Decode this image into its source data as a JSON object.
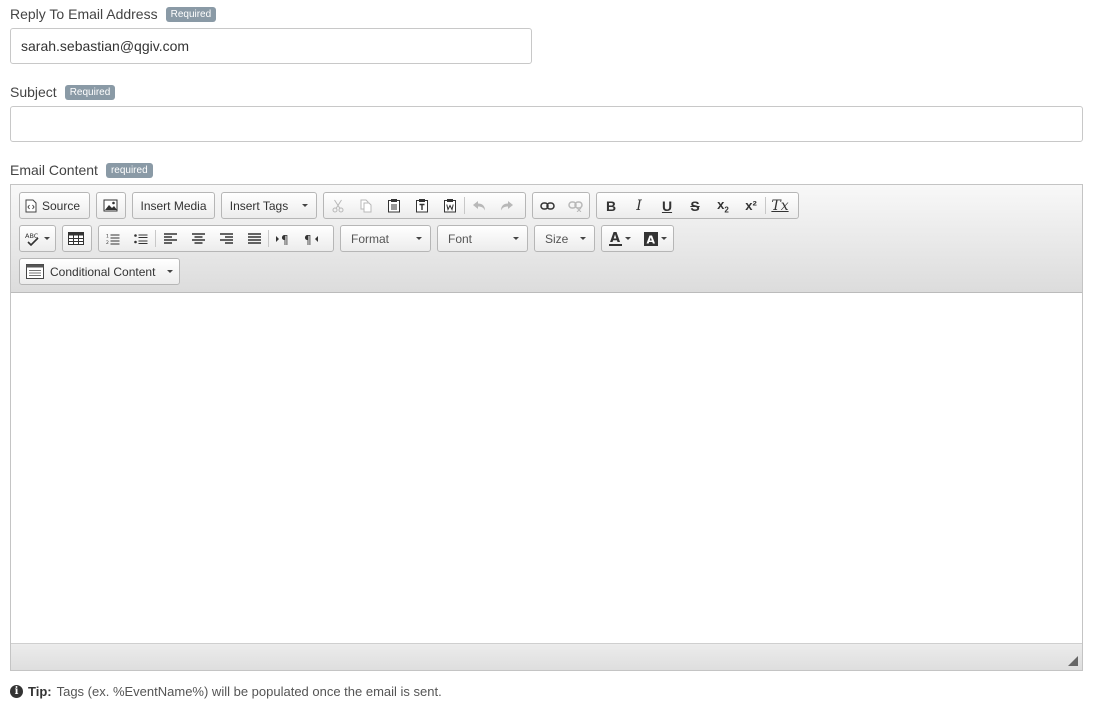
{
  "reply_to": {
    "label": "Reply To Email Address",
    "badge": "Required",
    "value": "sarah.sebastian@qgiv.com"
  },
  "subject": {
    "label": "Subject",
    "badge": "Required",
    "value": ""
  },
  "email_content": {
    "label": "Email Content",
    "badge": "required"
  },
  "toolbar": {
    "source_label": "Source",
    "insert_media_label": "Insert Media",
    "insert_tags_label": "Insert Tags",
    "format_label": "Format",
    "font_label": "Font",
    "size_label": "Size",
    "conditional_content_label": "Conditional Content",
    "superscript_label": "x²",
    "clear_format_label": "Tx"
  },
  "tip": {
    "label": "Tip:",
    "text": "Tags (ex. %EventName%) will be populated once the email is sent."
  },
  "colors": {
    "badge": "#8a9aa6",
    "disabled_icon": "#b8b8b8"
  }
}
